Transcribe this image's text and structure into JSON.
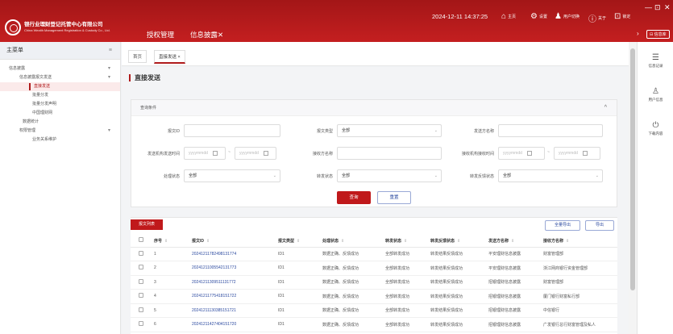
{
  "header": {
    "org_name_cn": "银行业理财登记托管中心有限公司",
    "org_name_en": "China Wealth Management Registration & Custody Co., Ltd.",
    "nav": [
      {
        "label": "授权管理",
        "active": false
      },
      {
        "label": "信息披露✕",
        "active": true
      }
    ],
    "datetime": "2024-12-11 14:37:25",
    "actions": [
      {
        "icon": "home-icon",
        "glyph": "⌂",
        "label": "主页"
      },
      {
        "icon": "settings-icon",
        "glyph": "⚙",
        "label": "设置"
      },
      {
        "icon": "users-icon",
        "glyph": "♟",
        "label": "用户切换"
      },
      {
        "icon": "info-icon",
        "glyph": "ⓘ",
        "label": "关于"
      },
      {
        "icon": "lock-icon",
        "glyph": "⊡",
        "label": "锁定"
      }
    ],
    "window": {
      "minimize": "—",
      "restore": "⊡",
      "close": "✕"
    },
    "collapse_arrow": "›",
    "info_button": "⊟ 信息库"
  },
  "sidebar": {
    "title": "主菜单",
    "collapse": "≡",
    "items": [
      {
        "label": "信息披露",
        "level": 1,
        "expand": "▾",
        "active": false
      },
      {
        "label": "信息披露报文发送",
        "level": 2,
        "expand": "▾",
        "active": false
      },
      {
        "label": "直接发送",
        "level": 3,
        "active": true
      },
      {
        "label": "批量分发",
        "level": 3,
        "active": false
      },
      {
        "label": "批量分发声明",
        "level": 3,
        "active": false
      },
      {
        "label": "中国理财网",
        "level": 3,
        "active": false
      },
      {
        "label": "数据统计",
        "level": 2,
        "active": false
      },
      {
        "label": "权限管理",
        "level": 1,
        "expand": "▾",
        "active": false
      },
      {
        "label": "业务关系维护",
        "level": 2,
        "active": false
      }
    ]
  },
  "tabs": [
    {
      "label": "首页",
      "active": false
    },
    {
      "label": "直接发送 ×",
      "active": true
    }
  ],
  "page": {
    "title": "直接发送",
    "query": {
      "header": "查询条件",
      "toggle": "^",
      "fields": {
        "report_id": {
          "label": "报文ID",
          "value": ""
        },
        "report_type": {
          "label": "报文类型",
          "value": "全部"
        },
        "sender_name": {
          "label": "发送方名称",
          "value": ""
        },
        "sender_time": {
          "label": "发送机构发送时间",
          "placeholder": "yyyymmdd"
        },
        "receiver_name": {
          "label": "接收方名称",
          "value": ""
        },
        "receiver_time": {
          "label": "接收机构接收时间",
          "placeholder": "yyyymmdd"
        },
        "process_status": {
          "label": "处理状态",
          "value": "全部"
        },
        "forward_status": {
          "label": "转发状态",
          "value": "全部"
        },
        "forward_feedback_status": {
          "label": "转发反馈状态",
          "value": "全部"
        }
      },
      "date_separator": "~",
      "search_button": "查询",
      "reset_button": "重置"
    },
    "list": {
      "tab_label": "报文列表",
      "export_all_button": "全量导出",
      "export_button": "导出",
      "columns": [
        "序号",
        "报文ID",
        "报文类型",
        "处理状态",
        "转发状态",
        "转发反馈状态",
        "发送方名称",
        "接收方名称"
      ],
      "sort_glyph": "⇕",
      "rows": [
        {
          "no": "1",
          "id": "20241211782498131774",
          "type": "ID1",
          "process": "数据正确、反馈成功",
          "forward": "全部转发成功",
          "feedback": "转发结果反馈成功",
          "sender": "平安理财信息披露",
          "receiver": "财富管理部"
        },
        {
          "no": "2",
          "id": "20241211005542131773",
          "type": "ID1",
          "process": "数据正确、反馈成功",
          "forward": "全部转发成功",
          "feedback": "转发结果反馈成功",
          "sender": "平安理财信息披露",
          "receiver": "浙江网商银行资金管理部"
        },
        {
          "no": "3",
          "id": "20241211309511131772",
          "type": "ID1",
          "process": "数据正确、反馈成功",
          "forward": "全部转发成功",
          "feedback": "转发结果反馈成功",
          "sender": "招银理财信息披露",
          "receiver": "财富管理部"
        },
        {
          "no": "4",
          "id": "20241211775418151722",
          "type": "ID1",
          "process": "数据正确、反馈成功",
          "forward": "全部转发成功",
          "feedback": "转发结果反馈成功",
          "sender": "招银理财信息披露",
          "receiver": "厦门银行财富私行部"
        },
        {
          "no": "5",
          "id": "20241211130385151721",
          "type": "ID1",
          "process": "数据正确、反馈成功",
          "forward": "全部转发成功",
          "feedback": "转发结果反馈成功",
          "sender": "招银理财信息披露",
          "receiver": "中信银行"
        },
        {
          "no": "6",
          "id": "20241211427404151720",
          "type": "ID1",
          "process": "数据正确、反馈成功",
          "forward": "全部转发成功",
          "feedback": "转发结果反馈成功",
          "sender": "招银理财信息披露",
          "receiver": "广发银行总行财富管理及私人"
        }
      ]
    }
  },
  "right_panel": [
    {
      "icon": "message-icon",
      "glyph": "☰",
      "label": "信息记录"
    },
    {
      "icon": "user-info-icon",
      "glyph": "♙",
      "label": "用户信息"
    },
    {
      "icon": "power-icon",
      "glyph": "⏻",
      "label": "下载内容"
    }
  ],
  "colors": {
    "brand": "#c0191b",
    "link": "#2c4aa0",
    "active_bg": "#fbeaea"
  }
}
